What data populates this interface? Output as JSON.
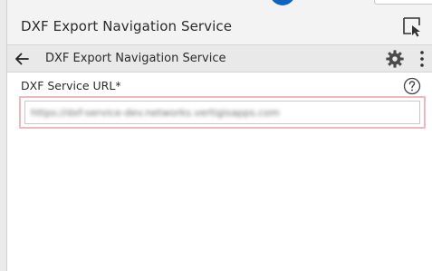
{
  "panel": {
    "title": "DXF Export Navigation Service"
  },
  "subheader": {
    "title": "DXF Export Navigation Service"
  },
  "form": {
    "url_label": "DXF Service URL*",
    "url_value": "https://dxf-service-dev.networks.vertigisapps.com"
  },
  "icons": {
    "select": "select-cursor-icon",
    "back": "arrow-left-icon",
    "settings": "gear-icon",
    "more": "more-vertical-icon",
    "help": "help-circle-icon"
  },
  "colors": {
    "accent": "#0a66c2",
    "input_highlight": "#f0b8bd"
  }
}
